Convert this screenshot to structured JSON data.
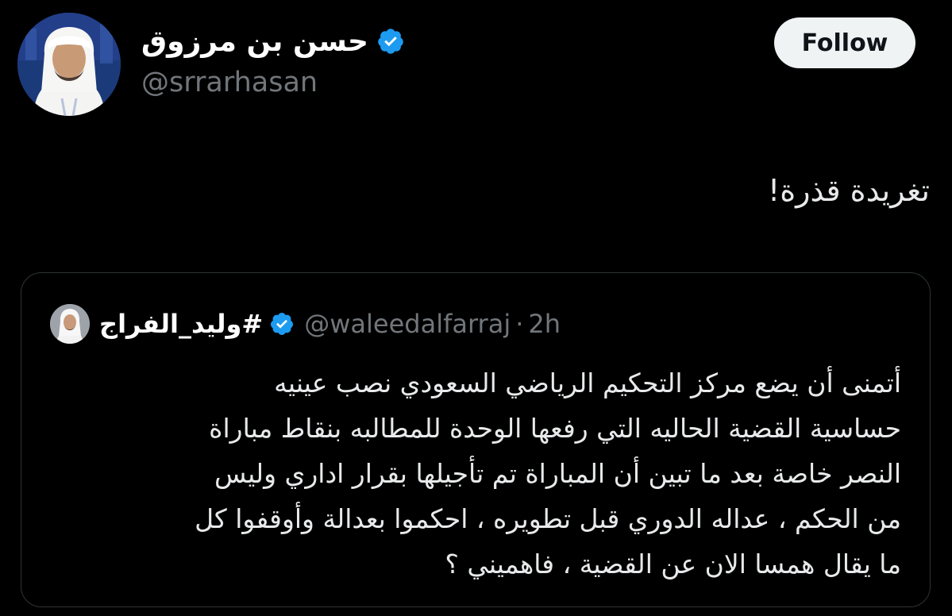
{
  "tweet": {
    "author": {
      "name": "حسن بن مرزوق",
      "handle": "@srrarhasan",
      "verified": true
    },
    "follow_label": "Follow",
    "text": "تغريدة قذرة!",
    "quoted": {
      "author_name": "#وليد_الفراج",
      "handle": "@waleedalfarraj",
      "separator": "·",
      "time": "2h",
      "verified": true,
      "lines": [
        "أتمنى أن يضع مركز التحكيم الرياضي السعودي نصب عينيه",
        "حساسية القضية الحاليه التي رفعها الوحدة للمطالبه بنقاط مباراة",
        "النصر خاصة بعد ما تبين أن المباراة تم تأجيلها بقرار اداري وليس",
        "من الحكم ، عداله الدوري قبل تطويره ، احكموا بعدالة وأوقفوا كل",
        "ما يقال همسا الان عن القضية ، فاهميني ؟"
      ]
    }
  },
  "colors": {
    "background": "#000000",
    "verified_badge": "#1d9bf0",
    "follow_bg": "#eff3f4",
    "secondary_text": "#71767b",
    "border": "#2f3336"
  },
  "icons": {
    "verified": "verified-badge-icon"
  }
}
